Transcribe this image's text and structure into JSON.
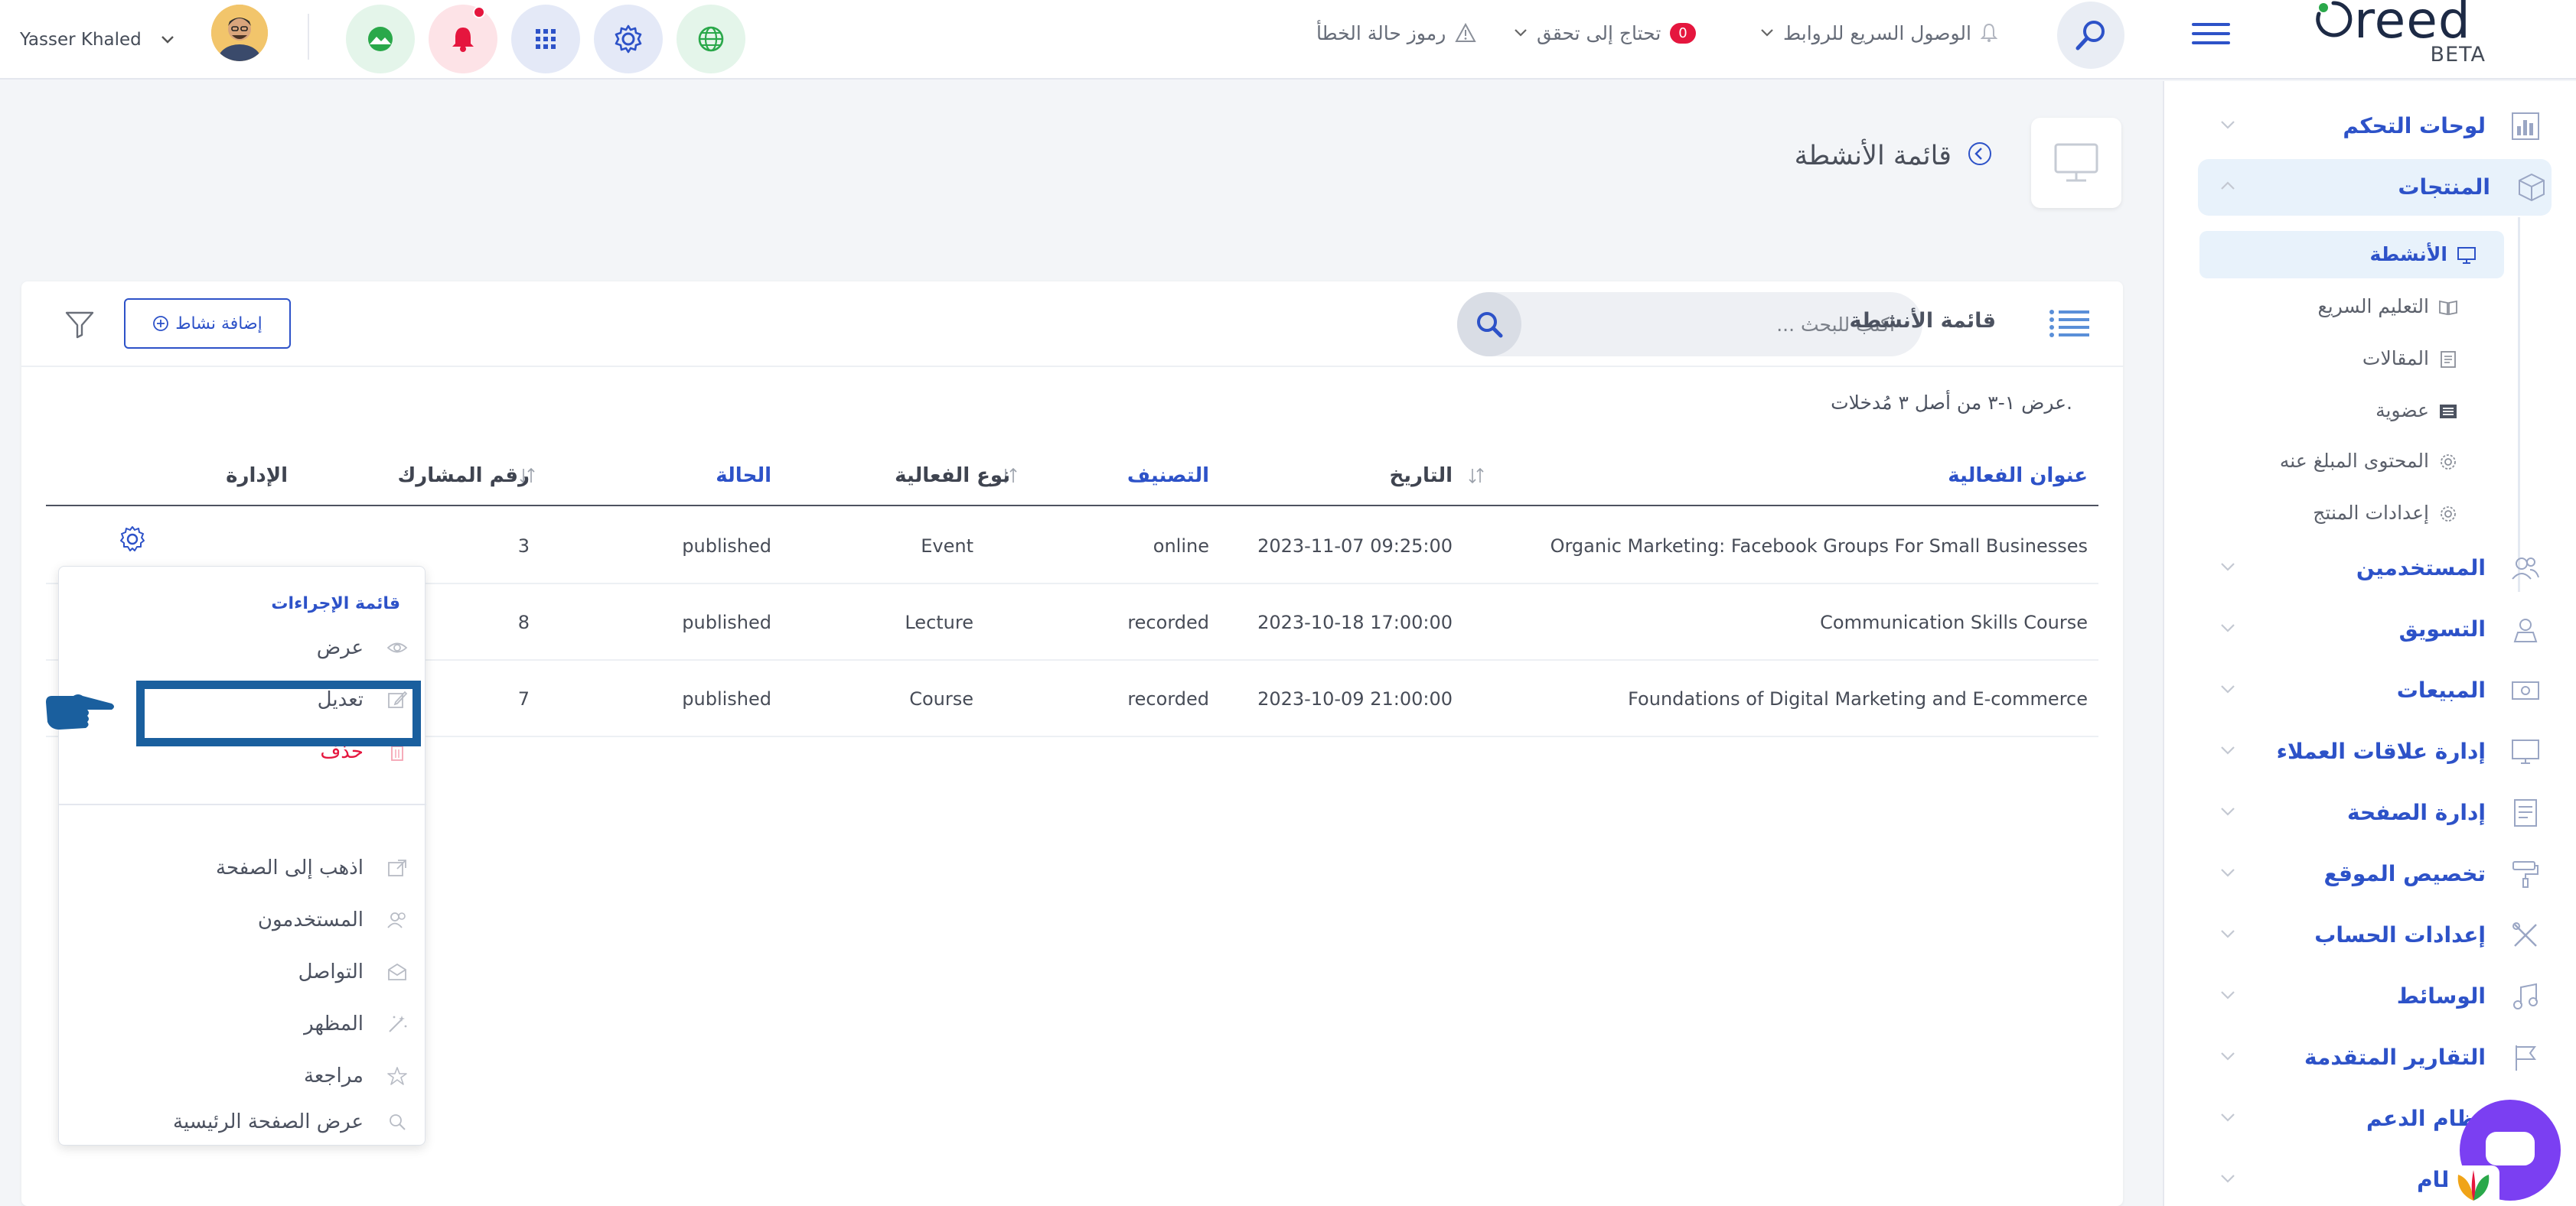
{
  "header": {
    "user_name": "Yasser Khaled",
    "brand_name": "reed",
    "brand_tag": "BETA",
    "quick_links_label": "الوصول السريع للروابط",
    "needs_check_label": "تحتاج إلى تحقق",
    "needs_check_count": "0",
    "error_codes_label": "رموز حالة الخطأ",
    "icons": {
      "app1": "landscape-icon",
      "notifications": "bell-icon",
      "apps": "grid-icon",
      "settings": "gear-icon",
      "language": "globe-icon",
      "search": "search-icon",
      "menu": "hamburger-icon"
    },
    "colors": {
      "bell_bg": "#fde3e7",
      "accent": "#2d52c8",
      "badge": "#e5163e"
    }
  },
  "sidebar": {
    "items": [
      {
        "label": "لوحات التحكم",
        "icon": "chart-icon"
      },
      {
        "label": "المنتجات",
        "icon": "cube-icon",
        "active": true
      },
      {
        "label": "المستخدمين",
        "icon": "users-icon"
      },
      {
        "label": "التسويق",
        "icon": "megaphone-icon"
      },
      {
        "label": "المبيعات",
        "icon": "cash-icon"
      },
      {
        "label": "إدارة علاقات العملاء",
        "icon": "crm-icon"
      },
      {
        "label": "إدارة الصفحة",
        "icon": "page-icon"
      },
      {
        "label": "تخصيص الموقع",
        "icon": "paint-roller-icon"
      },
      {
        "label": "إعدادات الحساب",
        "icon": "tools-icon"
      },
      {
        "label": "الوسائط",
        "icon": "music-icon"
      },
      {
        "label": "التقارير المتقدمة",
        "icon": "flag-icon"
      },
      {
        "label": "نظام الدعم",
        "icon": "support-icon"
      },
      {
        "label": "النظام",
        "icon": "system-icon"
      }
    ],
    "sub_items": [
      {
        "label": "الأنشطة",
        "icon": "monitor-icon",
        "active": true
      },
      {
        "label": "التعليم السريع",
        "icon": "book-icon"
      },
      {
        "label": "المقالات",
        "icon": "article-icon"
      },
      {
        "label": "عضوية",
        "icon": "list-icon"
      },
      {
        "label": "المحتوى المبلغ عنه",
        "icon": "gear-icon"
      },
      {
        "label": "إعدادات المنتج",
        "icon": "gear-icon"
      }
    ]
  },
  "page": {
    "title": "قائمة الأنشطة",
    "icon": "monitor-icon"
  },
  "card": {
    "list_title": "قائمة الأنشطة",
    "search_placeholder": "اكتب للبحث ...",
    "add_button": "إضافة نشاط",
    "entries_info": "عرض ١-٣ من أصل ٣ مُدخلات.",
    "columns": {
      "title": "عنوان الفعالية",
      "date": "التاريخ",
      "category": "التصنيف",
      "type": "نوع الفعالية",
      "status": "الحالة",
      "participants": "رقم المشارك",
      "manage": "الإدارة"
    },
    "rows": [
      {
        "title": "Organic Marketing: Facebook Groups For Small Businesses",
        "date": "2023-11-07 09:25:00",
        "category": "online",
        "type": "Event",
        "status": "published",
        "participants": "3"
      },
      {
        "title": "Communication Skills Course",
        "date": "2023-10-18 17:00:00",
        "category": "recorded",
        "type": "Lecture",
        "status": "published",
        "participants": "8"
      },
      {
        "title": "Foundations of Digital Marketing and E-commerce",
        "date": "2023-10-09 21:00:00",
        "category": "recorded",
        "type": "Course",
        "status": "published",
        "participants": "7"
      }
    ]
  },
  "actions_menu": {
    "title": "قائمة الإجراءات",
    "items": [
      {
        "label": "عرض",
        "icon": "eye-icon"
      },
      {
        "label": "تعديل",
        "icon": "edit-icon",
        "highlighted": true
      },
      {
        "label": "حذف",
        "icon": "trash-icon",
        "danger": true
      },
      {
        "label": "اذهب إلى الصفحة",
        "icon": "external-page-icon"
      },
      {
        "label": "المستخدمون",
        "icon": "users-icon"
      },
      {
        "label": "التواصل",
        "icon": "mail-icon"
      },
      {
        "label": "المظهر",
        "icon": "magic-wand-icon"
      },
      {
        "label": "مراجعة",
        "icon": "star-icon"
      },
      {
        "label": "عرض الصفحة الرئيسية",
        "icon": "search-icon"
      }
    ]
  }
}
